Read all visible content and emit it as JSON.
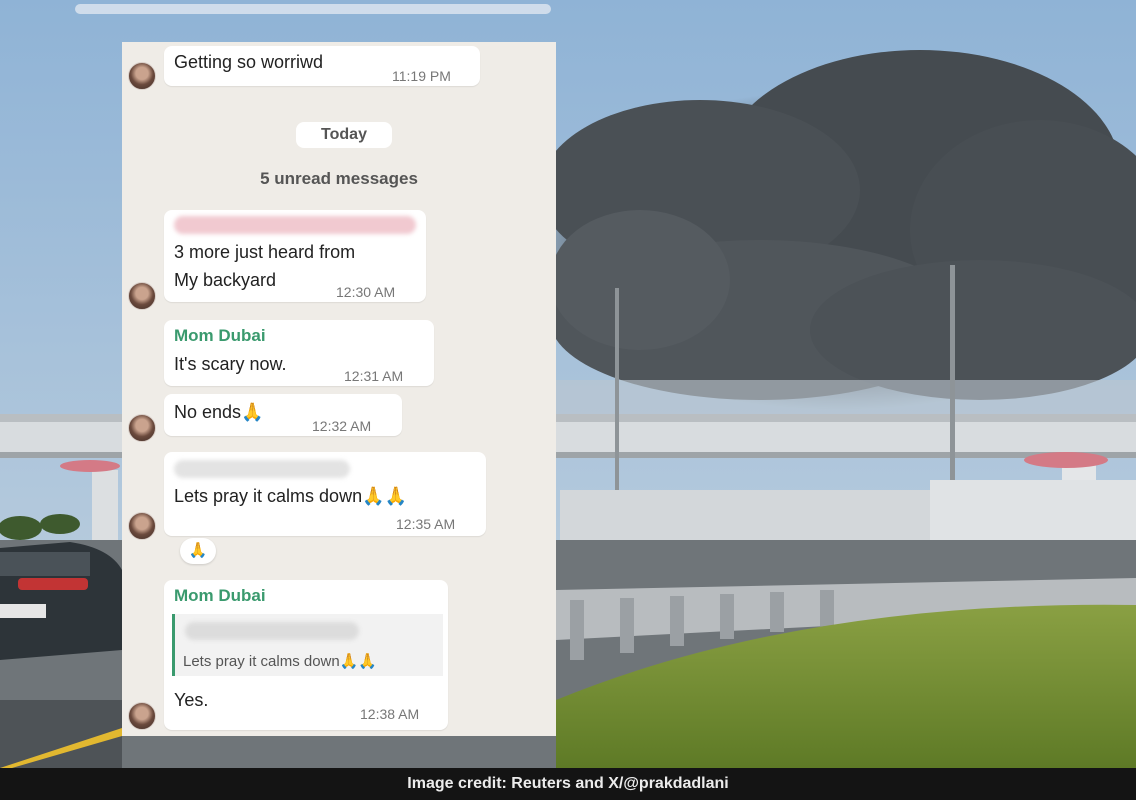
{
  "chat": {
    "messages": [
      {
        "text": "Getting so worriwd",
        "time": "11:19 PM"
      },
      {
        "line1": "3 more just heard from",
        "line2": "My backyard",
        "time": "12:30 AM"
      },
      {
        "sender": "Mom Dubai",
        "text": "It's scary now.",
        "time": "12:31 AM"
      },
      {
        "text": "No ends🙏",
        "time": "12:32 AM"
      },
      {
        "text": "Lets pray it calms down🙏🙏",
        "time": "12:35 AM"
      },
      {
        "sender": "Mom Dubai",
        "quote": "Lets pray it calms down🙏🙏",
        "text": "Yes.",
        "time": "12:38 AM"
      }
    ],
    "date_divider": "Today",
    "unread_label": "5 unread messages",
    "reaction": "🙏"
  },
  "footer": {
    "credit": "Image credit: Reuters and X/@prakdadlani"
  }
}
